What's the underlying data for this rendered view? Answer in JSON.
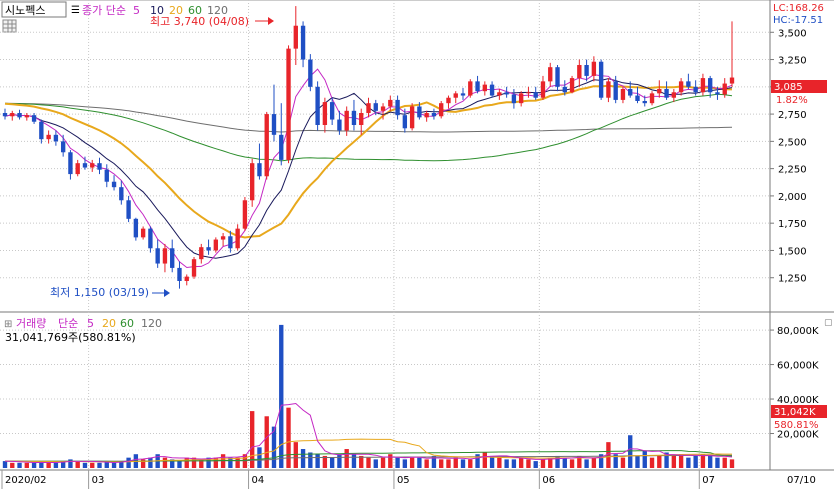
{
  "header": {
    "stock_name": "시노펙스",
    "price_label": "종가 단순",
    "ma_periods": [
      "5",
      "10",
      "20",
      "60",
      "120"
    ],
    "lc": "LC:168.26",
    "hc": "HC:-17.51"
  },
  "price_panel": {
    "y_ticks": [
      "3,500",
      "3,250",
      "3,000",
      "2,750",
      "2,500",
      "2,250",
      "2,000",
      "1,750",
      "1,500",
      "1,250"
    ],
    "ylim": [
      1000,
      3750
    ],
    "current_price": "3,085",
    "current_change": "1.82%",
    "max_annotation": "최고 3,740 (04/08)",
    "min_annotation": "최저 1,150 (03/19)"
  },
  "volume_panel": {
    "label": "거래량",
    "ma_label": "단순",
    "ma_periods": [
      "5",
      "20",
      "60",
      "120"
    ],
    "volume_text": "31,041,769주(580.81%)",
    "y_ticks": [
      "80,000K",
      "60,000K",
      "40,000K",
      "20,000K"
    ],
    "ylim": [
      0,
      87000
    ],
    "current_volume": "31,042K",
    "current_ratio": "580.81%"
  },
  "x_axis": {
    "labels": [
      "2020/02",
      "03",
      "04",
      "05",
      "06",
      "07",
      "07/10"
    ]
  },
  "colors": {
    "up": "#e8242a",
    "down": "#1f4fc4",
    "ma5": "#c428c4",
    "ma10": "#1a1a5c",
    "ma20": "#e8a81c",
    "ma60": "#2f8f2f",
    "ma120": "#6e6e6e",
    "grid": "#c8c8c8"
  },
  "chart_data": {
    "type": "candlestick",
    "series": [
      {
        "date": "2020/02",
        "candles": [
          [
            2760,
            2800,
            2700,
            2730
          ],
          [
            2730,
            2780,
            2690,
            2760
          ],
          [
            2760,
            2790,
            2700,
            2720
          ],
          [
            2720,
            2760,
            2690,
            2740
          ],
          [
            2740,
            2760,
            2660,
            2680
          ],
          [
            2680,
            2700,
            2480,
            2520
          ],
          [
            2520,
            2600,
            2480,
            2560
          ],
          [
            2560,
            2600,
            2460,
            2500
          ],
          [
            2500,
            2560,
            2360,
            2400
          ],
          [
            2400,
            2420,
            2150,
            2200
          ],
          [
            2200,
            2330,
            2180,
            2300
          ],
          [
            2300,
            2360,
            2240,
            2260
          ]
        ]
      },
      {
        "date": "03",
        "candles": [
          [
            2260,
            2330,
            2220,
            2300
          ],
          [
            2300,
            2350,
            2200,
            2240
          ],
          [
            2240,
            2290,
            2080,
            2130
          ],
          [
            2130,
            2190,
            2050,
            2080
          ],
          [
            2080,
            2140,
            1920,
            1960
          ],
          [
            1960,
            2000,
            1760,
            1790
          ],
          [
            1790,
            1800,
            1590,
            1620
          ],
          [
            1620,
            1720,
            1600,
            1700
          ],
          [
            1700,
            1720,
            1480,
            1520
          ],
          [
            1520,
            1600,
            1340,
            1380
          ],
          [
            1380,
            1560,
            1300,
            1520
          ],
          [
            1520,
            1600,
            1300,
            1340
          ],
          [
            1340,
            1400,
            1150,
            1220
          ],
          [
            1220,
            1280,
            1180,
            1260
          ],
          [
            1260,
            1440,
            1240,
            1420
          ],
          [
            1420,
            1560,
            1380,
            1530
          ],
          [
            1530,
            1600,
            1460,
            1500
          ],
          [
            1500,
            1620,
            1480,
            1600
          ],
          [
            1600,
            1660,
            1540,
            1630
          ],
          [
            1630,
            1680,
            1480,
            1520
          ],
          [
            1520,
            1740,
            1500,
            1700
          ],
          [
            1700,
            1990,
            1680,
            1960
          ]
        ]
      },
      {
        "date": "04",
        "candles": [
          [
            1960,
            2340,
            1900,
            2300
          ],
          [
            2300,
            2480,
            2150,
            2180
          ],
          [
            2180,
            2770,
            2150,
            2750
          ],
          [
            2750,
            3020,
            2500,
            2560
          ],
          [
            2560,
            2850,
            2280,
            2330
          ],
          [
            2330,
            3380,
            2300,
            3350
          ],
          [
            3350,
            3740,
            3200,
            3560
          ],
          [
            3560,
            3600,
            3180,
            3250
          ],
          [
            3250,
            3300,
            2960,
            3000
          ],
          [
            3000,
            3050,
            2600,
            2650
          ],
          [
            2650,
            2900,
            2580,
            2860
          ],
          [
            2860,
            2900,
            2650,
            2700
          ],
          [
            2700,
            2780,
            2560,
            2600
          ],
          [
            2600,
            2820,
            2550,
            2780
          ],
          [
            2780,
            2880,
            2600,
            2650
          ],
          [
            2650,
            2800,
            2560,
            2760
          ],
          [
            2760,
            2900,
            2720,
            2850
          ],
          [
            2850,
            2880,
            2740,
            2780
          ],
          [
            2780,
            2850,
            2700,
            2820
          ],
          [
            2820,
            2920,
            2780,
            2880
          ]
        ]
      },
      {
        "date": "05",
        "candles": [
          [
            2880,
            2920,
            2700,
            2740
          ],
          [
            2740,
            2800,
            2580,
            2620
          ],
          [
            2620,
            2850,
            2600,
            2820
          ],
          [
            2820,
            2860,
            2700,
            2720
          ],
          [
            2720,
            2780,
            2680,
            2760
          ],
          [
            2760,
            2800,
            2700,
            2730
          ],
          [
            2730,
            2870,
            2710,
            2850
          ],
          [
            2850,
            2920,
            2800,
            2900
          ],
          [
            2900,
            2960,
            2850,
            2940
          ],
          [
            2940,
            2990,
            2880,
            2920
          ],
          [
            2920,
            3070,
            2900,
            3050
          ],
          [
            3050,
            3100,
            2940,
            2960
          ],
          [
            2960,
            3050,
            2920,
            3020
          ],
          [
            3020,
            3050,
            2900,
            2920
          ],
          [
            2920,
            2980,
            2880,
            2950
          ],
          [
            2950,
            3000,
            2900,
            2930
          ],
          [
            2930,
            2980,
            2800,
            2850
          ],
          [
            2850,
            2960,
            2820,
            2940
          ],
          [
            2940,
            3000,
            2900,
            2950
          ],
          [
            2950,
            3000,
            2880,
            2900
          ]
        ]
      },
      {
        "date": "06",
        "candles": [
          [
            2900,
            3100,
            2880,
            3050
          ],
          [
            3050,
            3220,
            3000,
            3180
          ],
          [
            3180,
            3200,
            2960,
            3000
          ],
          [
            3000,
            3060,
            2920,
            2950
          ],
          [
            2950,
            3100,
            2940,
            3080
          ],
          [
            3080,
            3250,
            3000,
            3200
          ],
          [
            3200,
            3250,
            3050,
            3100
          ],
          [
            3100,
            3280,
            3050,
            3230
          ],
          [
            3230,
            3250,
            2880,
            2900
          ],
          [
            2900,
            3080,
            2860,
            3050
          ],
          [
            3050,
            3100,
            2850,
            2880
          ],
          [
            2880,
            3000,
            2850,
            2980
          ],
          [
            2980,
            3050,
            2900,
            2920
          ],
          [
            2920,
            3000,
            2850,
            2870
          ],
          [
            2870,
            2920,
            2820,
            2850
          ],
          [
            2850,
            2960,
            2830,
            2940
          ],
          [
            2940,
            3060,
            2900,
            2980
          ],
          [
            2980,
            3050,
            2880,
            2900
          ],
          [
            2900,
            2980,
            2860,
            2950
          ],
          [
            2950,
            3080,
            2920,
            3050
          ],
          [
            3050,
            3120,
            2980,
            3000
          ],
          [
            3000,
            3060,
            2920,
            2950
          ]
        ]
      },
      {
        "date": "07",
        "candles": [
          [
            2950,
            3120,
            2920,
            3080
          ],
          [
            3080,
            3100,
            2900,
            2950
          ],
          [
            2950,
            3000,
            2880,
            2930
          ],
          [
            2930,
            3080,
            2900,
            3030
          ],
          [
            3030,
            3600,
            3000,
            3085
          ]
        ]
      }
    ],
    "volume": [
      4,
      3,
      3,
      3,
      3,
      4,
      3,
      3,
      4,
      5,
      4,
      3,
      3,
      3,
      4,
      3,
      4,
      6,
      8,
      5,
      6,
      8,
      6,
      5,
      4,
      6,
      6,
      5,
      6,
      6,
      8,
      6,
      6,
      8,
      33,
      12,
      30,
      24,
      83,
      35,
      15,
      11,
      9,
      8,
      7,
      6,
      8,
      11,
      8,
      7,
      6,
      5,
      6,
      8,
      6,
      5,
      6,
      6,
      5,
      7,
      5,
      5,
      6,
      5,
      5,
      8,
      9,
      7,
      6,
      5,
      5,
      6,
      5,
      4,
      5,
      6,
      7,
      6,
      5,
      7,
      5,
      6,
      8,
      15,
      8,
      6,
      19,
      7,
      10,
      6,
      7,
      9,
      7,
      8,
      6,
      7,
      8,
      7,
      6,
      6,
      5,
      5,
      6,
      5,
      31
    ],
    "moving_averages": [
      "5",
      "10",
      "20",
      "60",
      "120"
    ]
  }
}
